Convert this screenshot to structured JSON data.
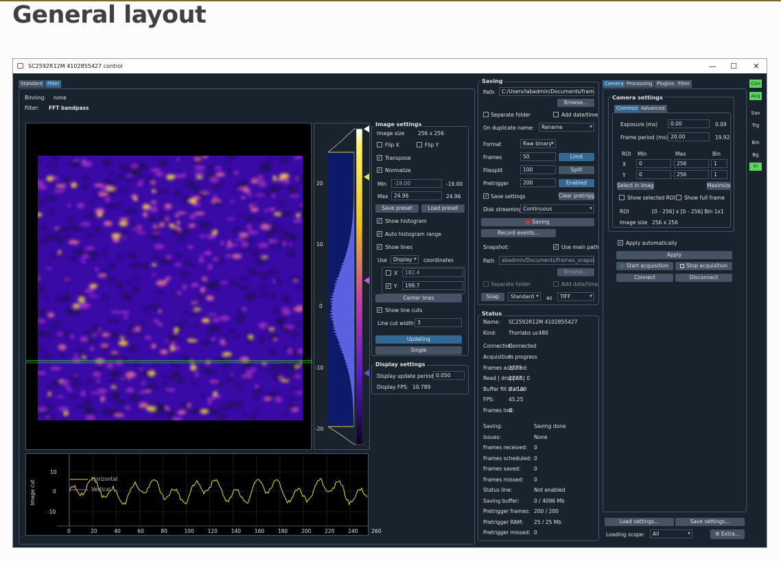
{
  "page": {
    "heading": "General layout"
  },
  "window": {
    "title": "SC2592R12M 4102855427 control",
    "buttons": [
      "—",
      "☐",
      "✕"
    ]
  },
  "left_tabs": [
    "Standard",
    "Filter"
  ],
  "filter_info": {
    "binning_label": "Binning:",
    "binning_value": "none",
    "filter_label": "Filter:",
    "filter_value": "FFT bandpass"
  },
  "colorbar": {
    "ticks": [
      "20",
      "10",
      "0",
      "-10",
      "-20"
    ]
  },
  "linecut": {
    "ylabel": "Image cut",
    "legend": [
      "Horizontal",
      "Vertical"
    ],
    "yticks": [
      "10",
      "0",
      "-10"
    ],
    "xticks": [
      "0",
      "20",
      "40",
      "60",
      "80",
      "100",
      "120",
      "140",
      "160",
      "180",
      "200",
      "220",
      "240",
      "260"
    ]
  },
  "image_settings": {
    "title": "Image settings",
    "image_size_label": "Image size",
    "image_size": "256 x 256",
    "flip_x": "Flip X",
    "flip_y": "Flip Y",
    "transpose": "Transpose",
    "normalize": "Normalize",
    "min_label": "Min",
    "min_value": "-19.00",
    "min_display": "-19.00",
    "max_label": "Max",
    "max_value": "24.96",
    "max_display": "24.96",
    "save_preset": "Save preset",
    "load_preset": "Load preset",
    "show_histogram": "Show histogram",
    "auto_histogram_range": "Auto histogram range",
    "show_lines": "Show lines",
    "use_label": "Use",
    "use_value": "Display",
    "coordinates_label": "coordinates",
    "x_label": "X",
    "x_value": "182.4",
    "y_label": "Y",
    "y_value": "199.7",
    "center_lines": "Center lines",
    "show_line_cuts": "Show line cuts",
    "line_cut_width_label": "Line cut width",
    "line_cut_width": "3",
    "updating": "Updating",
    "single": "Single"
  },
  "display_settings": {
    "title": "Display settings",
    "update_period_label": "Display update period:",
    "update_period": "0.050",
    "fps_label": "Display FPS:",
    "fps": "10.789"
  },
  "saving": {
    "title": "Saving",
    "path_label": "Path",
    "path": "C:/Users/labadmin/Documents/frames",
    "browse": "Browse...",
    "separate_folder": "Separate folder",
    "add_date_time": "Add date/time",
    "on_duplicate_label": "On duplicate name:",
    "on_duplicate": "Rename",
    "format_label": "Format",
    "format": "Raw binary",
    "frames_label": "Frames",
    "frames": "50",
    "limit": "Limit",
    "filesplit_label": "Filesplit",
    "filesplit": "100",
    "split": "Split",
    "pretrigger_label": "Pretrigger",
    "pretrigger": "200",
    "enabled": "Enabled",
    "save_settings": "Save settings",
    "clear_pretrigger": "Clear pretrigger",
    "disk_streaming_label": "Disk streaming",
    "disk_streaming": "Continuous",
    "saving_button": "Saving",
    "record_events": "Record events...",
    "snapshot_label": "Snapshot:",
    "use_main_path": "Use main path",
    "snap_path_label": "Path",
    "snap_path": "abadmin/Documents/frames_snapshot",
    "snap_browse": "Browse...",
    "snap_separate_folder": "Separate folder",
    "snap_add_date_time": "Add date/time",
    "snap": "Snap",
    "snap_mode": "Standard",
    "as_label": "as",
    "snap_format": "TIFF"
  },
  "status": {
    "title": "Status",
    "rows": [
      [
        "Name:",
        "SC2592R12M 4102855427"
      ],
      [
        "Kind:",
        "Thorlabs uc480"
      ],
      [
        "Connection:",
        "Connected"
      ],
      [
        "Acquisition:",
        "In progress"
      ],
      [
        "Frames acquired:",
        "2777"
      ],
      [
        "Read | dropped:",
        "2777 | 0"
      ],
      [
        "Buffer fill status:",
        "2 / 100"
      ],
      [
        "FPS:",
        "45.25"
      ],
      [
        "Frames lost:",
        "0"
      ],
      [
        "Saving:",
        "Saving done"
      ],
      [
        "Issues:",
        "None"
      ],
      [
        "Frames received:",
        "0"
      ],
      [
        "Frames scheduled:",
        "0"
      ],
      [
        "Frames saved:",
        "0"
      ],
      [
        "Frames missed:",
        "0"
      ],
      [
        "Status line:",
        "Not enabled"
      ],
      [
        "Saving buffer:",
        "0 / 4096 Mb"
      ],
      [
        "Pretrigger frames:",
        "200 / 200"
      ],
      [
        "Pretrigger RAM:",
        "25 / 25 Mb"
      ],
      [
        "Pretrigger missed:",
        "0"
      ]
    ]
  },
  "right_tabs": [
    "Camera",
    "Processing",
    "Plugins",
    "Filter"
  ],
  "camera_settings": {
    "title": "Camera settings",
    "subtabs": [
      "Common",
      "Advanced"
    ],
    "exposure_label": "Exposure (ms)",
    "exposure": "0.00",
    "exposure_actual": "0.09",
    "frame_period_label": "Frame period (ms)",
    "frame_period": "20.00",
    "frame_period_actual": "19.92",
    "roi_label": "ROI",
    "min_label": "Min",
    "max_label": "Max",
    "bin_label": "Bin",
    "x_label": "X",
    "x_min": "0",
    "x_max": "256",
    "x_bin": "1",
    "y_label": "Y",
    "y_min": "0",
    "y_max": "256",
    "y_bin": "1",
    "select_in_image": "Select in image",
    "maximize": "Maximize",
    "show_selected_roi": "Show selected ROI",
    "show_full_frame": "Show full frame",
    "roi_info_label": "ROI",
    "roi_info": "[0 - 256] x [0 - 256]  Bin 1x1",
    "image_size_label": "Image size",
    "image_size": "256 x 256"
  },
  "acquisition": {
    "apply_automatically": "Apply automatically",
    "apply": "Apply",
    "start_acquisition": "Start acquisition",
    "stop_acquisition": "Stop acquisition",
    "connect": "Connect",
    "disconnect": "Disconnect"
  },
  "bottom_right": {
    "load_settings": "Load settings...",
    "save_settings": "Save settings...",
    "loading_scope_label": "Loading scope:",
    "loading_scope": "All",
    "extra": "Extra..."
  },
  "side_buttons": [
    "Con",
    "Acq",
    "Sav",
    "Trg",
    "Bin",
    "Bg",
    "Fl"
  ],
  "colors": {
    "bg": "#19232d",
    "border": "#455364",
    "accent": "#346792",
    "on": "#5fd35f"
  }
}
